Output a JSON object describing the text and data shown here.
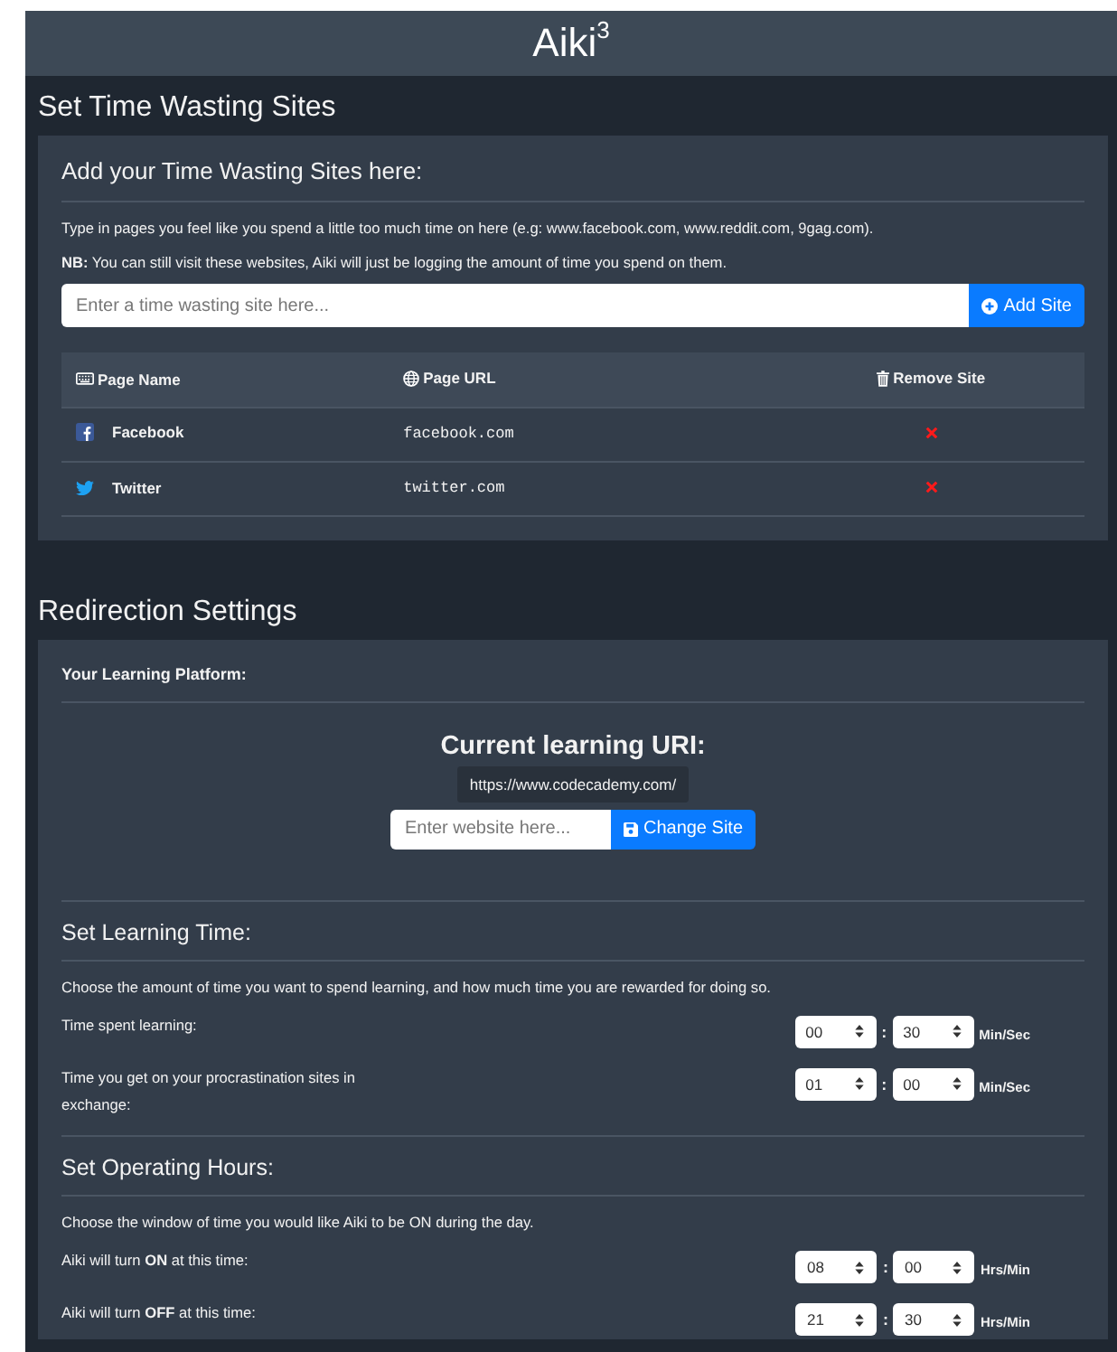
{
  "header": {
    "title": "Aiki$^{3}$"
  },
  "wasting_sites": {
    "heading": "Set Time Wasting Sites",
    "card_title": "Add your Time Wasting Sites here:",
    "intro": "Type in pages you feel like you spend a little too much time on here (e.g: www.facebook.com, www.reddit.com, 9gag.com).",
    "note": "**NB:** You can still visit these websites, Aiki will just be logging the amount of time you spend on them.",
    "input": {
      "placeholder": "Enter a time wasting site here..."
    },
    "add_button": "Add Site",
    "table": {
      "columns": [
        "Page Name",
        "Page URL",
        "Remove Site"
      ],
      "rows": [
        {
          "name": "Facebook",
          "url": "facebook.com"
        },
        {
          "name": "Twitter",
          "url": "twitter.com"
        }
      ]
    }
  },
  "redirection": {
    "heading": "Redirection Settings",
    "platform_title": "Your Learning Platform:",
    "uri_label": "Current learning URI:",
    "uri": "https://www.codecademy.com/",
    "input": {
      "placeholder": "Enter website here..."
    },
    "change_button": "Change Site",
    "learning_time": {
      "title": "Set Learning Time:",
      "description": "Choose the amount of time you want to spend learning, and how much time you are rewarded for doing so.",
      "rows": [
        {
          "label": "Time spent learning:",
          "first": "00",
          "separator": ":",
          "second": "30",
          "unit": "Min/Sec"
        },
        {
          "label": "Time you get on your procrastination sites in exchange:",
          "first": "01",
          "separator": ":",
          "second": "00",
          "unit": "Min/Sec"
        }
      ]
    },
    "operating_hours": {
      "title": "Set Operating Hours:",
      "description": "Choose the window of time you would like Aiki to be ON during the day.",
      "rows": [
        {
          "label": "Aiki will turn **ON** at this time:",
          "first": "08",
          "separator": ":",
          "second": "00",
          "unit": "Hrs/Min"
        },
        {
          "label": "Aiki will turn **OFF** at this time:",
          "first": "21",
          "separator": ":",
          "second": "30",
          "unit": "Hrs/Min"
        }
      ]
    }
  }
}
